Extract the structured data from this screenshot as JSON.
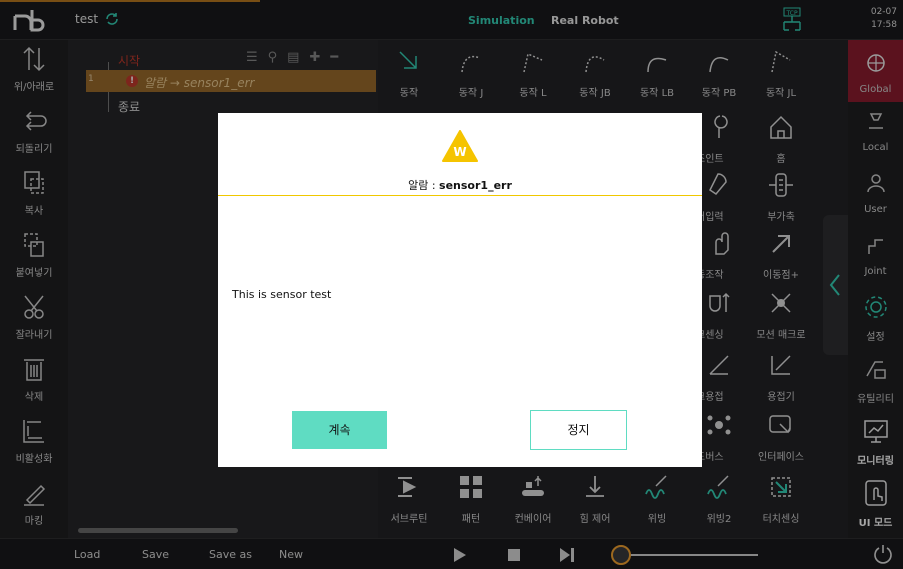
{
  "header": {
    "project_name": "test",
    "mode_simulation": "Simulation",
    "mode_real": "Real Robot",
    "tcp_badge": "TCP",
    "date": "02-07",
    "time": "17:58"
  },
  "left_tools": [
    {
      "label": "위/아래로",
      "icon": "up-down-arrows-icon"
    },
    {
      "label": "되돌리기",
      "icon": "undo-icon"
    },
    {
      "label": "복사",
      "icon": "copy-icon"
    },
    {
      "label": "붙여넣기",
      "icon": "paste-icon"
    },
    {
      "label": "잘라내기",
      "icon": "scissors-icon"
    },
    {
      "label": "삭제",
      "icon": "trash-icon"
    },
    {
      "label": "비활성화",
      "icon": "disable-icon"
    },
    {
      "label": "마킹",
      "icon": "marker-icon"
    }
  ],
  "tree": {
    "start": "시작",
    "row_number": "1",
    "alarm_prefix": "알람",
    "alarm_target": "→ sensor1_err",
    "end": "종료"
  },
  "grid": {
    "row1": [
      "동작",
      "동작 J",
      "동작 L",
      "동작 JB",
      "동작 LB",
      "동작 PB",
      "동작 JL"
    ],
    "right_visible": [
      {
        "label": "조인트"
      },
      {
        "label": "홈"
      },
      {
        "label": "저입력"
      },
      {
        "label": "부가축"
      },
      {
        "label": "동조작"
      },
      {
        "label": "이동점+"
      },
      {
        "label": "크센싱"
      },
      {
        "label": "모션 매크로"
      },
      {
        "label": "크용접"
      },
      {
        "label": "용접기"
      },
      {
        "label": "드버스"
      },
      {
        "label": "인터페이스"
      }
    ],
    "bottom": [
      "서브루틴",
      "패턴",
      "컨베이어",
      "힘 제어",
      "위빙",
      "위빙2",
      "터치센싱"
    ]
  },
  "right_tools": [
    {
      "label": "Global",
      "active": true
    },
    {
      "label": "Local"
    },
    {
      "label": "User"
    },
    {
      "label": "Joint"
    },
    {
      "label": "설정"
    },
    {
      "label": "유틸리티"
    },
    {
      "label": "모니터링"
    },
    {
      "label": "UI 모드"
    }
  ],
  "bottom_bar": {
    "load": "Load",
    "save": "Save",
    "save_as": "Save as",
    "new": "New"
  },
  "dialog": {
    "badge": "W",
    "title_prefix": "알람 : ",
    "title_value": "sensor1_err",
    "message": "This is sensor test",
    "continue_label": "계속",
    "stop_label": "정지"
  },
  "colors": {
    "accent_teal": "#5fdcc2",
    "alarm_row": "#9a6a2c",
    "active_red": "#8c1d2e",
    "warning_yellow": "#f5c400"
  }
}
